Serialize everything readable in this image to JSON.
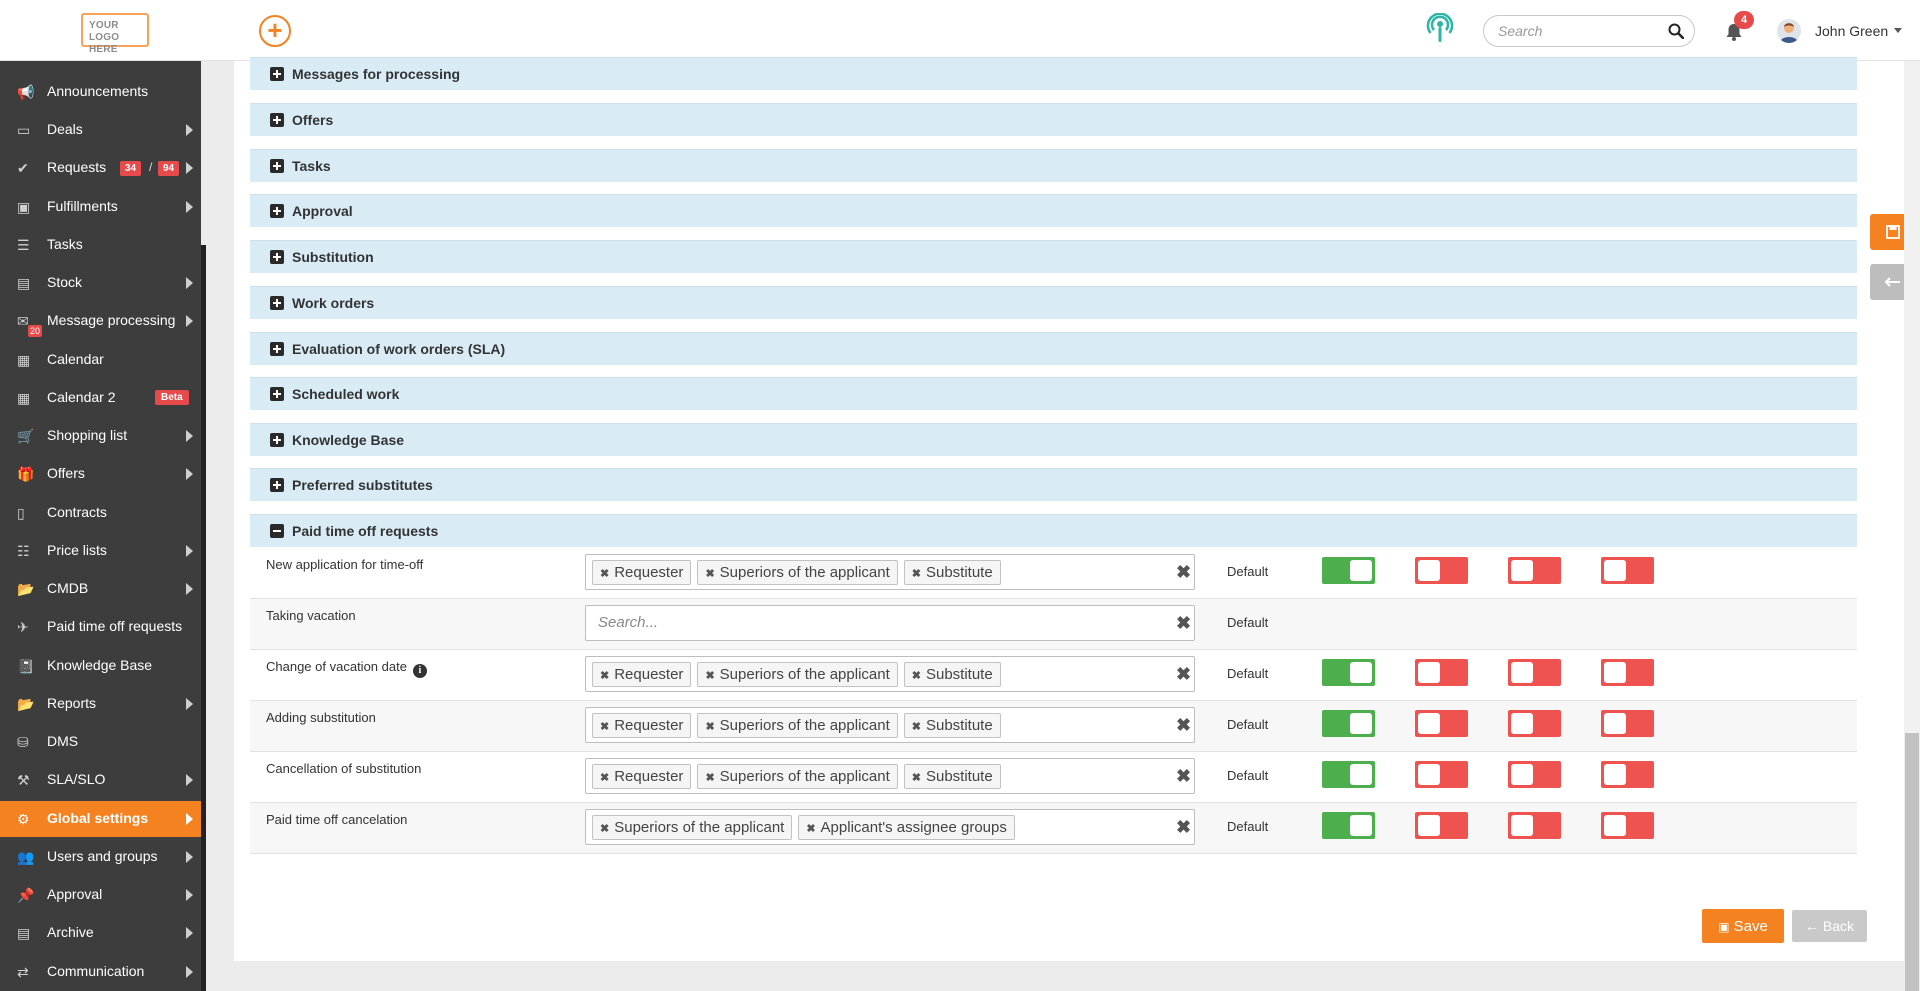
{
  "header": {
    "logo_text": "YOUR LOGO HERE",
    "search_placeholder": "Search",
    "notification_count": "4",
    "user_name": "John Green"
  },
  "sidebar": {
    "items": [
      {
        "label": "Announcements",
        "icon": "megaphone-icon",
        "arrow": false
      },
      {
        "label": "Deals",
        "icon": "credit-card-icon",
        "arrow": true
      },
      {
        "label": "Requests",
        "icon": "check-circle-icon",
        "arrow": true,
        "badge1": "34",
        "badge2": "94"
      },
      {
        "label": "Fulfillments",
        "icon": "box-icon",
        "arrow": true
      },
      {
        "label": "Tasks",
        "icon": "tasks-icon",
        "arrow": false
      },
      {
        "label": "Stock",
        "icon": "archive-icon",
        "arrow": true
      },
      {
        "label": "Message processing",
        "icon": "envelope-icon",
        "arrow": true,
        "mini_badge": "20"
      },
      {
        "label": "Calendar",
        "icon": "calendar-icon",
        "arrow": false
      },
      {
        "label": "Calendar 2",
        "icon": "calendar-icon",
        "arrow": false,
        "beta": "Beta"
      },
      {
        "label": "Shopping list",
        "icon": "cart-icon",
        "arrow": true
      },
      {
        "label": "Offers",
        "icon": "gift-icon",
        "arrow": true
      },
      {
        "label": "Contracts",
        "icon": "file-icon",
        "arrow": false
      },
      {
        "label": "Price lists",
        "icon": "file-text-icon",
        "arrow": true
      },
      {
        "label": "CMDB",
        "icon": "folder-open-icon",
        "arrow": true
      },
      {
        "label": "Paid time off requests",
        "icon": "plane-icon",
        "arrow": false
      },
      {
        "label": "Knowledge Base",
        "icon": "book-icon",
        "arrow": false
      },
      {
        "label": "Reports",
        "icon": "folder-open-icon",
        "arrow": true
      },
      {
        "label": "DMS",
        "icon": "database-icon",
        "arrow": false
      },
      {
        "label": "SLA/SLO",
        "icon": "gavel-icon",
        "arrow": true
      },
      {
        "label": "Global settings",
        "icon": "cogs-icon",
        "arrow": true,
        "active": true
      },
      {
        "label": "Users and groups",
        "icon": "users-icon",
        "arrow": true
      },
      {
        "label": "Approval",
        "icon": "thumbtack-icon",
        "arrow": true
      },
      {
        "label": "Archive",
        "icon": "archive-icon",
        "arrow": true
      },
      {
        "label": "Communication",
        "icon": "exchange-icon",
        "arrow": true
      }
    ]
  },
  "sections": [
    {
      "title": "Messages for processing",
      "expanded": false
    },
    {
      "title": "Offers",
      "expanded": false
    },
    {
      "title": "Tasks",
      "expanded": false
    },
    {
      "title": "Approval",
      "expanded": false
    },
    {
      "title": "Substitution",
      "expanded": false
    },
    {
      "title": "Work orders",
      "expanded": false
    },
    {
      "title": "Evaluation of work orders (SLA)",
      "expanded": false
    },
    {
      "title": "Scheduled work",
      "expanded": false
    },
    {
      "title": "Knowledge Base",
      "expanded": false
    },
    {
      "title": "Preferred substitutes",
      "expanded": false
    },
    {
      "title": "Paid time off requests",
      "expanded": true
    }
  ],
  "pto_rows": [
    {
      "label": "New application for time-off",
      "tags": [
        "Requester",
        "Superiors of the applicant",
        "Substitute"
      ],
      "default": "Default",
      "switches": [
        true,
        false,
        false,
        false
      ]
    },
    {
      "label": "Taking vacation",
      "tags": [],
      "placeholder": "Search...",
      "default": "Default",
      "switches": []
    },
    {
      "label": "Change of vacation date",
      "info": true,
      "tags": [
        "Requester",
        "Superiors of the applicant",
        "Substitute"
      ],
      "default": "Default",
      "switches": [
        true,
        false,
        false,
        false
      ]
    },
    {
      "label": "Adding substitution",
      "tags": [
        "Requester",
        "Superiors of the applicant",
        "Substitute"
      ],
      "default": "Default",
      "switches": [
        true,
        false,
        false,
        false
      ]
    },
    {
      "label": "Cancellation of substitution",
      "tags": [
        "Requester",
        "Superiors of the applicant",
        "Substitute"
      ],
      "default": "Default",
      "switches": [
        true,
        false,
        false,
        false
      ]
    },
    {
      "label": "Paid time off cancelation",
      "tags": [
        "Superiors of the applicant",
        "Applicant's assignee groups"
      ],
      "default": "Default",
      "switches": [
        true,
        false,
        false,
        false
      ]
    }
  ],
  "buttons": {
    "save": "Save",
    "back": "Back"
  }
}
